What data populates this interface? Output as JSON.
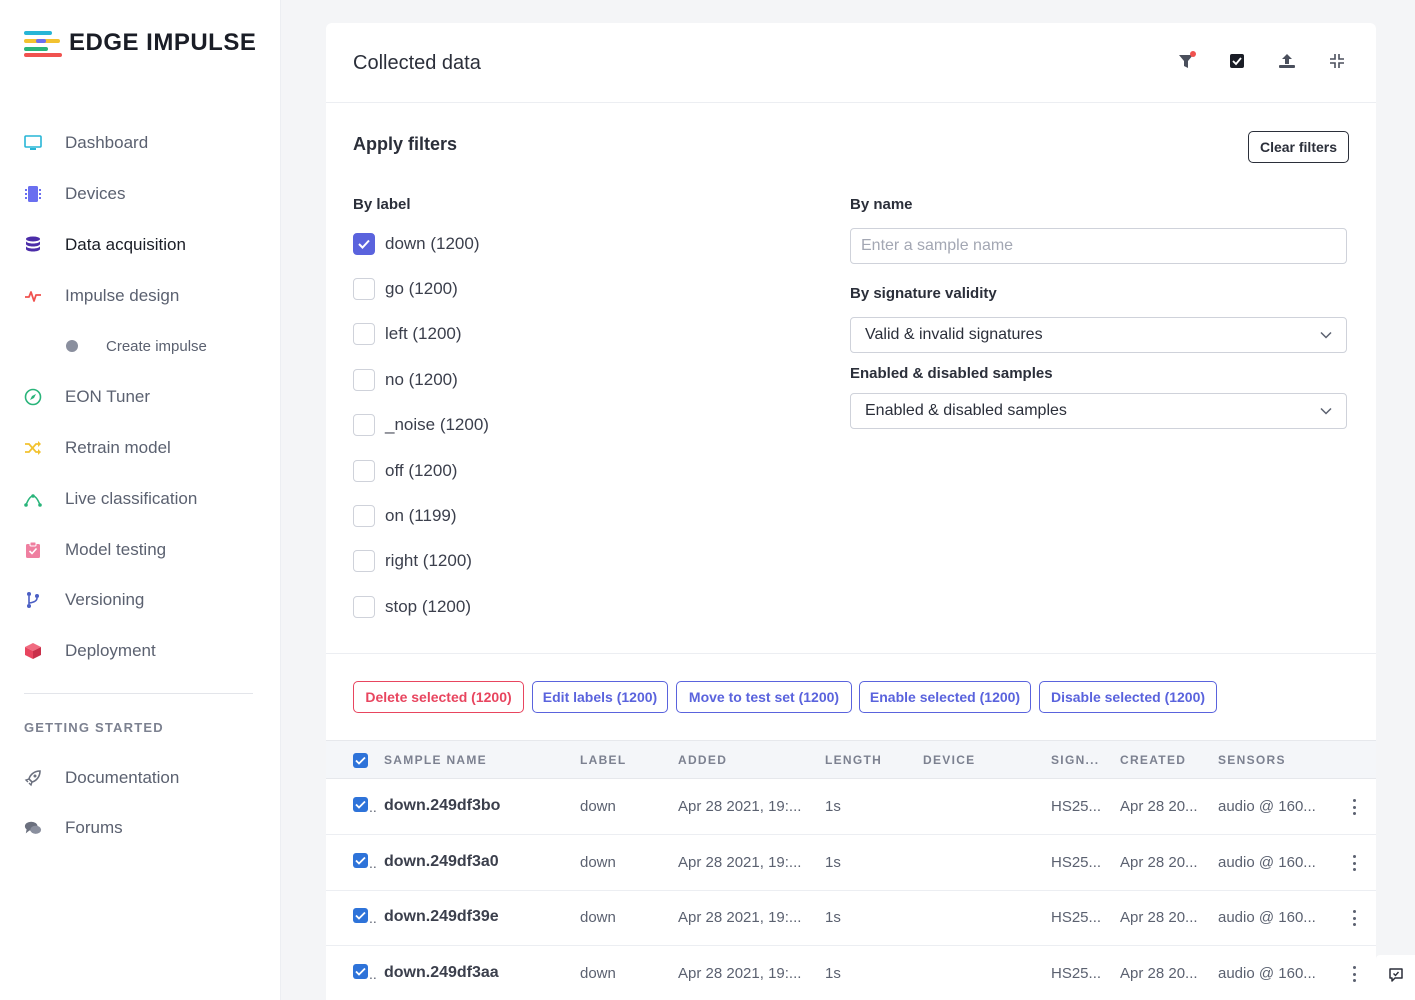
{
  "brand": {
    "name": "EDGE IMPULSE"
  },
  "sidebar": {
    "items": [
      {
        "label": "Dashboard",
        "icon": "monitor-icon",
        "color": "#27b5d6"
      },
      {
        "label": "Devices",
        "icon": "chip-icon",
        "color": "#6a6ff0"
      },
      {
        "label": "Data acquisition",
        "icon": "database-icon",
        "color": "#4b2ca8",
        "active": true
      },
      {
        "label": "Impulse design",
        "icon": "pulse-icon",
        "color": "#f0524f"
      },
      {
        "label": "Create impulse",
        "icon": "dot-icon",
        "sub": true
      },
      {
        "label": "EON Tuner",
        "icon": "compass-icon",
        "color": "#29b47a"
      },
      {
        "label": "Retrain model",
        "icon": "shuffle-icon",
        "color": "#f2c230"
      },
      {
        "label": "Live classification",
        "icon": "network-icon",
        "color": "#29b47a"
      },
      {
        "label": "Model testing",
        "icon": "clipboard-check-icon",
        "color": "#ef7fa0"
      },
      {
        "label": "Versioning",
        "icon": "branch-icon",
        "color": "#4b5fc4"
      },
      {
        "label": "Deployment",
        "icon": "cube-icon",
        "color": "#e8455f"
      }
    ],
    "section_title": "GETTING STARTED",
    "getting_started": [
      {
        "label": "Documentation",
        "icon": "rocket-icon"
      },
      {
        "label": "Forums",
        "icon": "chat-icon"
      }
    ]
  },
  "main": {
    "title": "Collected data",
    "filters": {
      "title": "Apply filters",
      "clear_label": "Clear filters",
      "by_label": "By label",
      "labels": [
        {
          "text": "down (1200)",
          "checked": true
        },
        {
          "text": "go (1200)",
          "checked": false
        },
        {
          "text": "left (1200)",
          "checked": false
        },
        {
          "text": "no (1200)",
          "checked": false
        },
        {
          "text": "_noise (1200)",
          "checked": false
        },
        {
          "text": "off (1200)",
          "checked": false
        },
        {
          "text": "on (1199)",
          "checked": false
        },
        {
          "text": "right (1200)",
          "checked": false
        },
        {
          "text": "stop (1200)",
          "checked": false
        }
      ],
      "by_name": "By name",
      "name_placeholder": "Enter a sample name",
      "by_signature": "By signature validity",
      "signature_value": "Valid & invalid signatures",
      "enabled_title": "Enabled & disabled samples",
      "enabled_value": "Enabled & disabled samples"
    },
    "actions": {
      "delete": "Delete selected (1200)",
      "edit": "Edit labels (1200)",
      "move": "Move to test set (1200)",
      "enable": "Enable selected (1200)",
      "disable": "Disable selected (1200)"
    },
    "table": {
      "headers": {
        "sample_name": "SAMPLE NAME",
        "label": "LABEL",
        "added": "ADDED",
        "length": "LENGTH",
        "device": "DEVICE",
        "signature": "SIGN...",
        "created": "CREATED",
        "sensors": "SENSORS"
      },
      "rows": [
        {
          "name": "down.249df3bo",
          "label": "down",
          "added": "Apr 28 2021, 19:...",
          "length": "1s",
          "device": "",
          "signature": "HS25...",
          "created": "Apr 28 20...",
          "sensors": "audio @ 160..."
        },
        {
          "name": "down.249df3a0",
          "label": "down",
          "added": "Apr 28 2021, 19:...",
          "length": "1s",
          "device": "",
          "signature": "HS25...",
          "created": "Apr 28 20...",
          "sensors": "audio @ 160..."
        },
        {
          "name": "down.249df39e",
          "label": "down",
          "added": "Apr 28 2021, 19:...",
          "length": "1s",
          "device": "",
          "signature": "HS25...",
          "created": "Apr 28 20...",
          "sensors": "audio @ 160..."
        },
        {
          "name": "down.249df3aa",
          "label": "down",
          "added": "Apr 28 2021, 19:...",
          "length": "1s",
          "device": "",
          "signature": "HS25...",
          "created": "Apr 28 20...",
          "sensors": "audio @ 160..."
        }
      ]
    }
  },
  "colors": {
    "accent": "#5a63dd",
    "danger": "#e8455f",
    "checkbox": "#2e73d9"
  }
}
